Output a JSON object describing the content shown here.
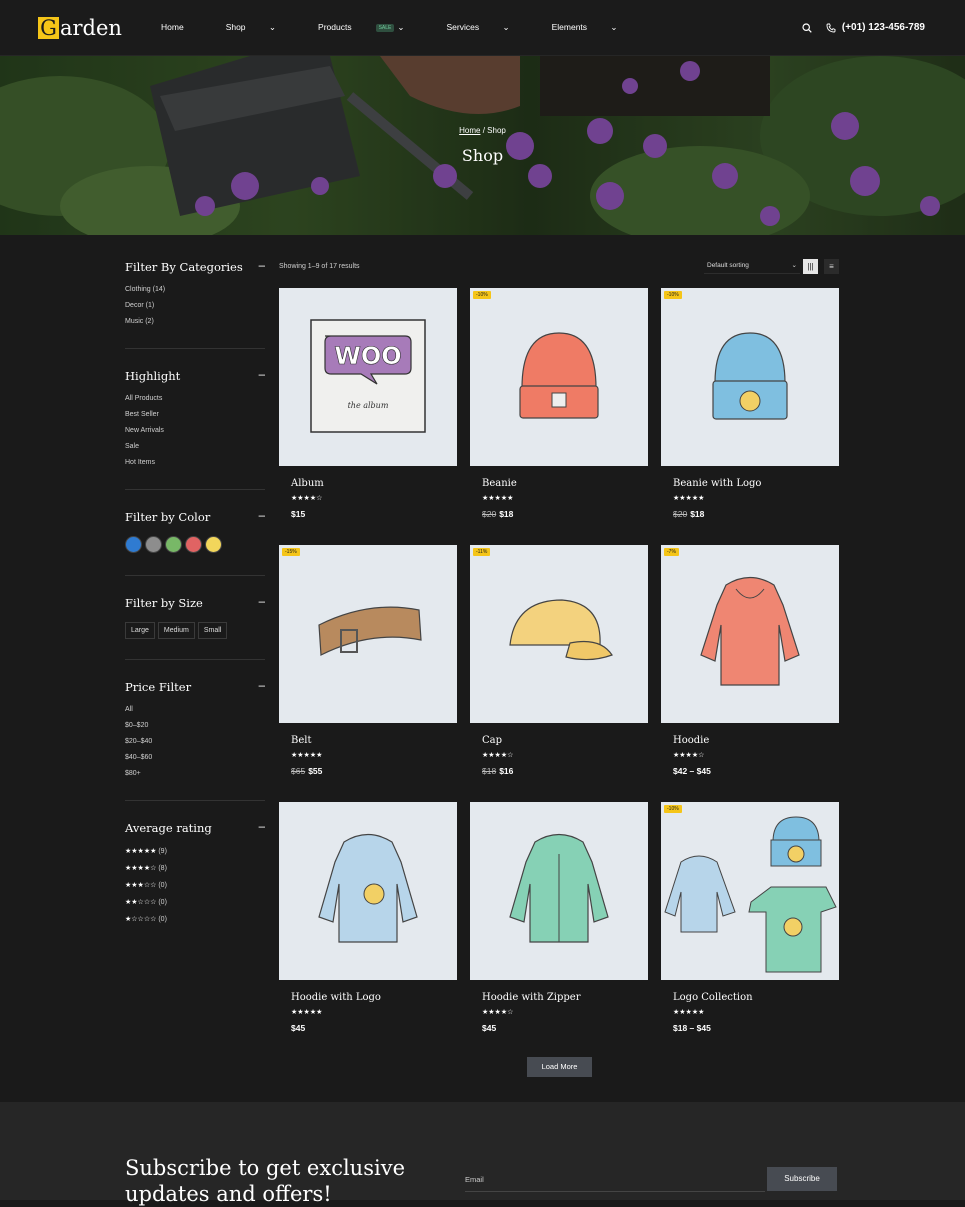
{
  "header": {
    "logo_letter": "G",
    "logo_rest": "arden",
    "nav": [
      {
        "label": "Home",
        "caret": ""
      },
      {
        "label": "Shop",
        "caret": "⌄"
      },
      {
        "label": "Products",
        "caret": "⌄",
        "badge": "SALE"
      },
      {
        "label": "Services",
        "caret": "⌄"
      },
      {
        "label": "Elements",
        "caret": "⌄"
      }
    ],
    "phone": "(+01) 123-456-789",
    "icons": [
      "search-icon",
      "phone-icon"
    ]
  },
  "hero": {
    "breadcrumb_home": "Home",
    "breadcrumb_sep": " / ",
    "breadcrumb_current": "Shop",
    "title": "Shop"
  },
  "sidebar": {
    "categories": {
      "title": "Filter By Categories",
      "toggle": "–",
      "items": [
        "Clothing (14)",
        "Decor (1)",
        "Music (2)"
      ]
    },
    "highlight": {
      "title": "Highlight",
      "toggle": "–",
      "items": [
        "All Products",
        "Best Seller",
        "New Arrivals",
        "Sale",
        "Hot Items"
      ]
    },
    "color": {
      "title": "Filter by Color",
      "toggle": "–",
      "swatches": [
        "#2f7bd1",
        "#8d8d8d",
        "#78b867",
        "#e06363",
        "#f2d65b"
      ]
    },
    "size": {
      "title": "Filter by Size",
      "toggle": "–",
      "items": [
        "Large",
        "Medium",
        "Small"
      ]
    },
    "price": {
      "title": "Price Filter",
      "toggle": "–",
      "items": [
        "All",
        "$0–$20",
        "$20–$40",
        "$40–$60",
        "$80+"
      ]
    },
    "rating": {
      "title": "Average rating",
      "toggle": "–",
      "items": [
        {
          "stars": "★★★★★",
          "count": "(9)"
        },
        {
          "stars": "★★★★☆",
          "count": "(8)"
        },
        {
          "stars": "★★★☆☆",
          "count": "(0)"
        },
        {
          "stars": "★★☆☆☆",
          "count": "(0)"
        },
        {
          "stars": "★☆☆☆☆",
          "count": "(0)"
        }
      ]
    }
  },
  "toolbar": {
    "results": "Showing 1–9 of 17 results",
    "sort": "Default sorting",
    "sort_caret": "⌄",
    "grid_view": "|||",
    "list_view": "≡"
  },
  "products": [
    {
      "name": "Album",
      "stars": "★★★★☆",
      "old_price": "",
      "price": "$15",
      "badge": "",
      "art": "album"
    },
    {
      "name": "Beanie",
      "stars": "★★★★★",
      "old_price": "$20",
      "price": "$18",
      "badge": "-10%",
      "art": "beanie"
    },
    {
      "name": "Beanie with Logo",
      "stars": "★★★★★",
      "old_price": "$20",
      "price": "$18",
      "badge": "-10%",
      "art": "beanie-logo"
    },
    {
      "name": "Belt",
      "stars": "★★★★★",
      "old_price": "$65",
      "price": "$55",
      "badge": "-15%",
      "art": "belt"
    },
    {
      "name": "Cap",
      "stars": "★★★★☆",
      "old_price": "$18",
      "price": "$16",
      "badge": "-11%",
      "art": "cap"
    },
    {
      "name": "Hoodie",
      "stars": "★★★★☆",
      "old_price": "",
      "price": "$42 – $45",
      "badge": "-7%",
      "art": "hoodie"
    },
    {
      "name": "Hoodie with Logo",
      "stars": "★★★★★",
      "old_price": "",
      "price": "$45",
      "badge": "",
      "art": "hoodie-logo"
    },
    {
      "name": "Hoodie with Zipper",
      "stars": "★★★★☆",
      "old_price": "",
      "price": "$45",
      "badge": "",
      "art": "hoodie-zipper"
    },
    {
      "name": "Logo Collection",
      "stars": "★★★★★",
      "old_price": "",
      "price": "$18 – $45",
      "badge": "-10%",
      "art": "logo-collection"
    }
  ],
  "album_art": {
    "logo": "WOO",
    "caption": "the album"
  },
  "load_more": "Load More",
  "subscribe": {
    "title": "Subscribe to get exclusive updates and offers!",
    "email_label": "Email",
    "button": "Subscribe"
  }
}
